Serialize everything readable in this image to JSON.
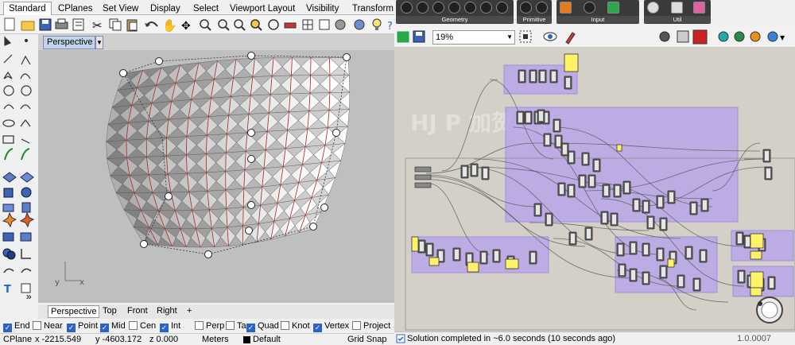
{
  "rhino": {
    "tabs": [
      "Standard",
      "CPlanes",
      "Set View",
      "Display",
      "Select",
      "Viewport Layout",
      "Visibility",
      "Transform"
    ],
    "viewport_title": "Perspective",
    "viewport_tabs": [
      "Perspective",
      "Top",
      "Front",
      "Right"
    ],
    "add_tab": "+",
    "axis": {
      "x": "x",
      "y": "y"
    },
    "osnaps": [
      {
        "label": "End",
        "checked": true
      },
      {
        "label": "Near",
        "checked": false
      },
      {
        "label": "Point",
        "checked": true
      },
      {
        "label": "Mid",
        "checked": true
      },
      {
        "label": "Cen",
        "checked": false
      },
      {
        "label": "Int",
        "checked": true
      },
      {
        "label": "Perp",
        "checked": false
      },
      {
        "label": "Tan",
        "checked": false
      },
      {
        "label": "Quad",
        "checked": true
      },
      {
        "label": "Knot",
        "checked": false
      },
      {
        "label": "Vertex",
        "checked": true
      },
      {
        "label": "Project",
        "checked": false
      }
    ],
    "status": {
      "cplane": "CPlane",
      "x": "x -2215.549",
      "y": "y -4603.172",
      "z": "z 0.000",
      "units": "Meters",
      "layer": "Default",
      "gridsnap": "Grid Snap"
    },
    "expand": "»"
  },
  "grasshopper": {
    "groups": [
      {
        "label": "Geometry"
      },
      {
        "label": "Primitive"
      },
      {
        "label": "Input"
      },
      {
        "label": "Util"
      }
    ],
    "zoom": "19%",
    "status_msg": "Solution completed in ~6.0 seconds (10 seconds ago)",
    "version": "1.0.0007",
    "watermark": "HJ P   加贺設計",
    "colors": {
      "group_purple": "#b9a6e8",
      "panel_yellow": "#fff26a"
    }
  }
}
